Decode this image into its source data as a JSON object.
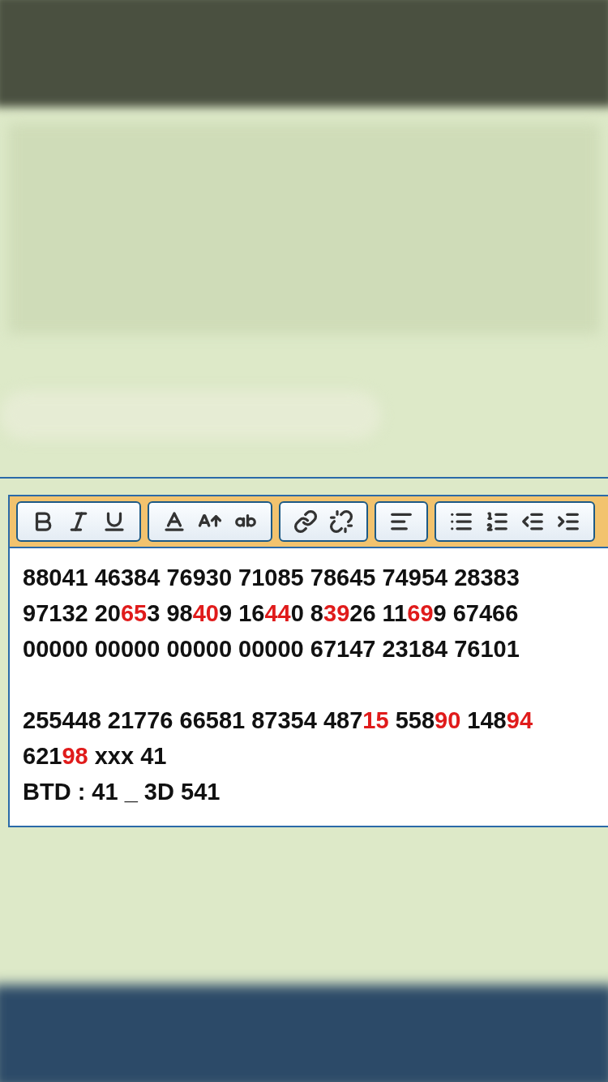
{
  "toolbar": [
    {
      "buttons": [
        {
          "kind": "bold"
        },
        {
          "kind": "italic"
        },
        {
          "kind": "underline"
        }
      ]
    },
    {
      "buttons": [
        {
          "kind": "font-color"
        },
        {
          "kind": "font-size"
        },
        {
          "kind": "text-case"
        }
      ]
    },
    {
      "buttons": [
        {
          "kind": "link"
        },
        {
          "kind": "unlink"
        }
      ]
    },
    {
      "buttons": [
        {
          "kind": "align-left"
        }
      ]
    },
    {
      "buttons": [
        {
          "kind": "bullet-list"
        },
        {
          "kind": "numbered-list"
        },
        {
          "kind": "outdent"
        },
        {
          "kind": "indent"
        }
      ]
    }
  ],
  "editor_paragraphs": [
    [
      [
        {
          "text": "88041 46384 76930 71085 78645 74954 28383",
          "highlight": false
        }
      ],
      [
        {
          "text": "97132 20",
          "highlight": false
        },
        {
          "text": "65",
          "highlight": true
        },
        {
          "text": "3 98",
          "highlight": false
        },
        {
          "text": "40",
          "highlight": true
        },
        {
          "text": "9 16",
          "highlight": false
        },
        {
          "text": "44",
          "highlight": true
        },
        {
          "text": "0 8",
          "highlight": false
        },
        {
          "text": "39",
          "highlight": true
        },
        {
          "text": "26 11",
          "highlight": false
        },
        {
          "text": "69",
          "highlight": true
        },
        {
          "text": "9 67466",
          "highlight": false
        }
      ],
      [
        {
          "text": "00000 00000 00000 00000 67147 23184 76101",
          "highlight": false
        }
      ]
    ],
    [
      [
        {
          "text": "255448 21776 66581 87354 487",
          "highlight": false
        },
        {
          "text": "15",
          "highlight": true
        },
        {
          "text": " 558",
          "highlight": false
        },
        {
          "text": "90",
          "highlight": true
        },
        {
          "text": " 148",
          "highlight": false
        },
        {
          "text": "94",
          "highlight": true
        }
      ],
      [
        {
          "text": "621",
          "highlight": false
        },
        {
          "text": "98",
          "highlight": true
        },
        {
          "text": " xxx 41",
          "highlight": false
        }
      ],
      [
        {
          "text": "BTD : 41 _ 3D 541",
          "highlight": false
        }
      ]
    ]
  ]
}
